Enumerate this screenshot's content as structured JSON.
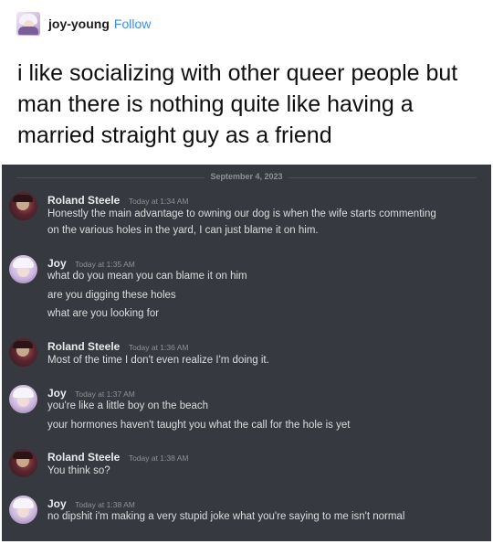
{
  "post": {
    "username": "joy-young",
    "follow_label": "Follow",
    "text": "i like socializing with other queer people but man there is nothing quite like having a married straight guy as a friend"
  },
  "chat": {
    "date_divider": "September 4, 2023",
    "messages": [
      {
        "author": "Roland Steele",
        "timestamp": "Today at 1:34 AM",
        "lines": [
          "Honestly the main advantage to owning our dog is when the wife starts commenting",
          "on the various holes in the yard, I can just blame it on him."
        ]
      },
      {
        "author": "Joy",
        "timestamp": "Today at 1:35 AM",
        "lines": [
          "what do you mean you can blame it on him",
          "are you digging these holes",
          "what are you looking for"
        ]
      },
      {
        "author": "Roland Steele",
        "timestamp": "Today at 1:36 AM",
        "lines": [
          "Most of the time I don't even realize I'm doing it."
        ]
      },
      {
        "author": "Joy",
        "timestamp": "Today at 1:37 AM",
        "lines": [
          "you're like a little boy on the beach",
          "your hormones haven't taught you what the call for the hole is yet"
        ]
      },
      {
        "author": "Roland Steele",
        "timestamp": "Today at 1:38 AM",
        "lines": [
          "You think so?"
        ]
      },
      {
        "author": "Joy",
        "timestamp": "Today at 1:38 AM",
        "lines": [
          "no dipshit i'm making a very stupid joke what you're saying to me isn't normal"
        ]
      }
    ]
  },
  "colors": {
    "follow": "#3d8ef0",
    "chat_background": "#36393f",
    "author_text": "#e9eaed",
    "message_text": "#dcddde",
    "timestamp_text": "#8e9297"
  }
}
